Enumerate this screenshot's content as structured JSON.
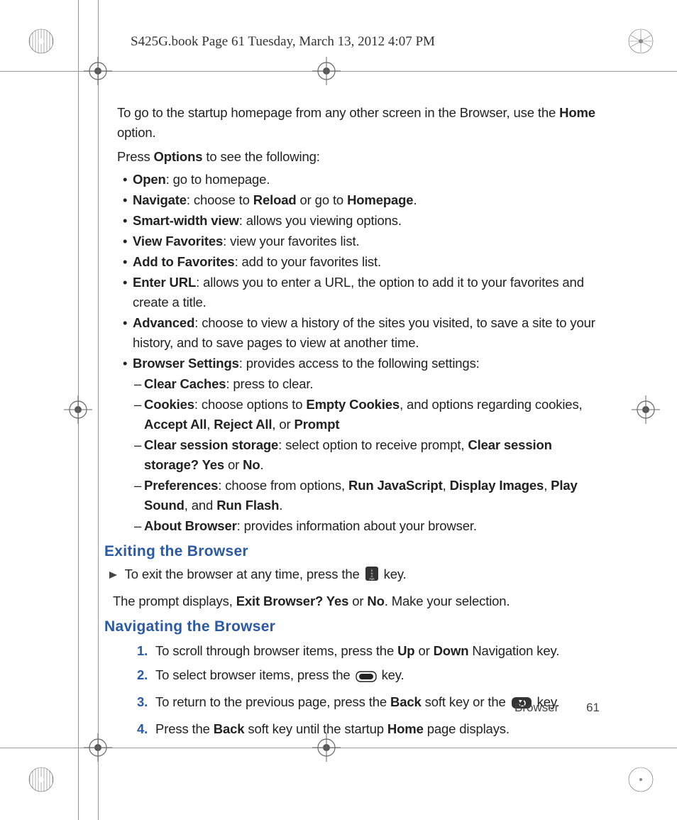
{
  "header": "S425G.book  Page 61  Tuesday, March 13, 2012  4:07 PM",
  "intro": {
    "pre": "To go to the startup homepage from any other screen in the Browser, use the ",
    "bold": "Home",
    "post": " option."
  },
  "options_intro": {
    "pre": "Press ",
    "bold": "Options",
    "post": " to see the following:"
  },
  "opts": {
    "open": {
      "b": "Open",
      "t": ": go to homepage."
    },
    "nav": {
      "b": "Navigate",
      "t1": ": choose to ",
      "b2": "Reload",
      "t2": " or go to ",
      "b3": "Homepage",
      "t3": "."
    },
    "smart": {
      "b": "Smart-width view",
      "t": ": allows you viewing options."
    },
    "viewfav": {
      "b": "View Favorites",
      "t": ": view your favorites list."
    },
    "addfav": {
      "b": "Add to Favorites",
      "t": ": add to your favorites list."
    },
    "url": {
      "b": "Enter URL",
      "t": ": allows you to enter a URL, the option to add it to your favorites and create a title."
    },
    "adv": {
      "b": "Advanced",
      "t": ": choose to view a history of the sites you visited, to save a site to your history, and to save pages to view at another time."
    },
    "bs": {
      "b": "Browser Settings",
      "t": ": provides access to the following settings:"
    }
  },
  "bs_sub": {
    "cache": {
      "b": "Clear Caches",
      "t": ": press to clear."
    },
    "cookies": {
      "b": "Cookies",
      "t1": ": choose options to ",
      "b2": "Empty Cookies",
      "t2": ", and options regarding cookies, ",
      "b3": "Accept All",
      "t3": ", ",
      "b4": "Reject All",
      "t4": ", or ",
      "b5": "Prompt"
    },
    "sess": {
      "b": "Clear session storage",
      "t1": ": select option to receive prompt, ",
      "b2": "Clear session storage? Yes",
      "t2": " or ",
      "b3": "No",
      "t3": "."
    },
    "pref": {
      "b": "Preferences",
      "t1": ": choose from options, ",
      "b2": "Run JavaScript",
      "t2": ", ",
      "b3": "Display Images",
      "t3": ", ",
      "b4": "Play Sound",
      "t4": ", and ",
      "b5": "Run Flash",
      "t5": "."
    },
    "about": {
      "b": "About Browser",
      "t": ": provides information about your browser."
    }
  },
  "h_exit": "Exiting the Browser",
  "exit_line": {
    "pre": "To exit the browser at any time, press the ",
    "post": " key."
  },
  "exit_prompt": {
    "pre": "The prompt displays, ",
    "b1": "Exit Browser? Yes",
    "mid": " or ",
    "b2": "No",
    "post": ". Make your selection."
  },
  "h_nav": "Navigating the Browser",
  "steps": {
    "s1": {
      "pre": "To scroll through browser items, press the ",
      "b1": "Up",
      "mid": " or ",
      "b2": "Down",
      "post": " Navigation key."
    },
    "s2": {
      "pre": "To select browser items, press the ",
      "post": " key."
    },
    "s3": {
      "pre": "To return to the previous page, press the ",
      "b1": "Back",
      "mid": " soft key or the ",
      "post": " key."
    },
    "s4": {
      "pre": "Press the ",
      "b1": "Back",
      "mid": " soft key until the startup ",
      "b2": "Home",
      "post": " page displays."
    }
  },
  "footer": {
    "section": "Browser",
    "page": "61"
  }
}
